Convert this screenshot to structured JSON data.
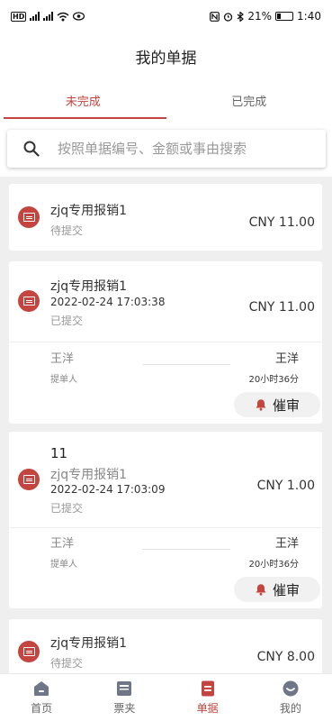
{
  "status_bar": {
    "time": "1:40",
    "battery": "21%",
    "sim1": "HD",
    "sim2": "5G",
    "sim3": "5G"
  },
  "header": {
    "title": "我的单据"
  },
  "tabs": [
    {
      "label": "未完成",
      "active": true
    },
    {
      "label": "已完成",
      "active": false
    }
  ],
  "search": {
    "placeholder": "按照单据编号、金额或事由搜索",
    "value": ""
  },
  "cards": [
    {
      "title": "zjq专用报销1",
      "status": "待提交",
      "amount": "CNY 11.00"
    },
    {
      "title": "zjq专用报销1",
      "datetime": "2022-02-24 17:03:38",
      "status": "已提交",
      "amount": "CNY 11.00",
      "submitter": "王洋",
      "submitter_role": "提单人",
      "approver": "王洋",
      "elapsed": "20小时36分",
      "urge_label": "催审"
    },
    {
      "name": "11",
      "title": "zjq专用报销1",
      "datetime": "2022-02-24 17:03:09",
      "status": "已提交",
      "amount": "CNY 1.00",
      "submitter": "王洋",
      "submitter_role": "提单人",
      "approver": "王洋",
      "elapsed": "20小时36分",
      "urge_label": "催审"
    },
    {
      "title": "zjq专用报销1",
      "status": "待提交",
      "amount": "CNY 8.00"
    }
  ],
  "bottom_nav": [
    {
      "label": "首页",
      "icon": "home-icon",
      "active": false
    },
    {
      "label": "票夹",
      "icon": "ticket-folder-icon",
      "active": false
    },
    {
      "label": "单据",
      "icon": "document-icon",
      "active": true
    },
    {
      "label": "我的",
      "icon": "profile-icon",
      "active": false
    }
  ],
  "colors": {
    "accent": "#c4453f",
    "background": "#efefef",
    "card": "#ffffff"
  }
}
